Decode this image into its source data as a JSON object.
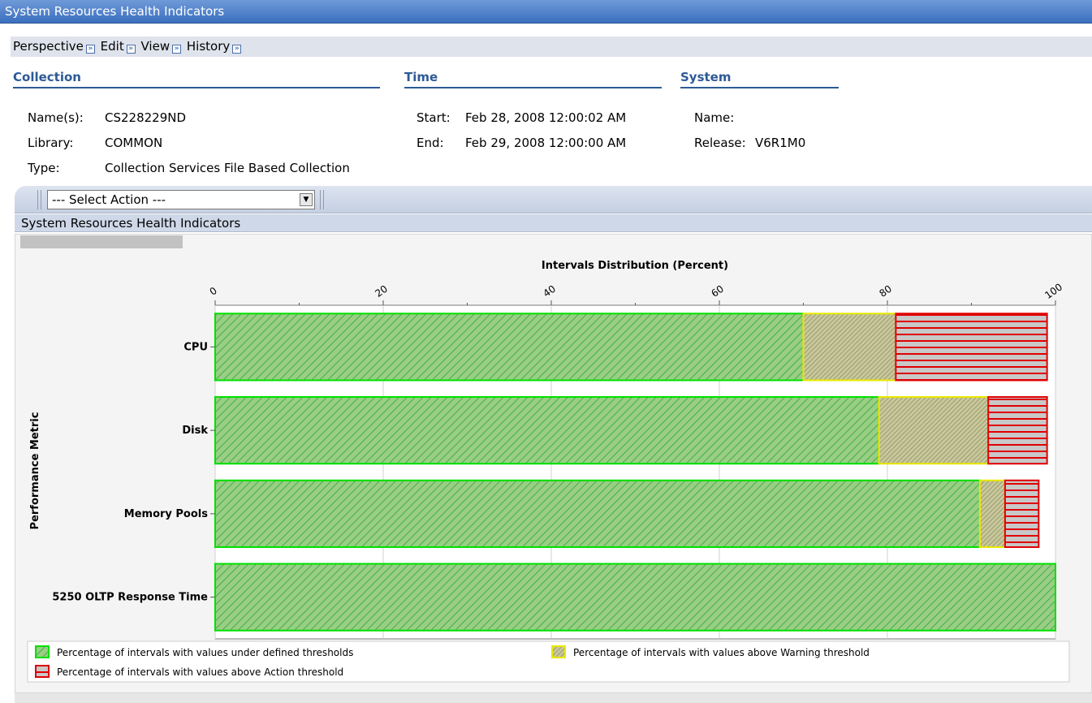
{
  "window": {
    "title": "System Resources Health Indicators"
  },
  "menu": {
    "items": [
      "Perspective",
      "Edit",
      "View",
      "History"
    ],
    "arrow_glyph": "»"
  },
  "collection": {
    "heading": "Collection",
    "names_label": "Name(s):",
    "names_value": "CS228229ND",
    "library_label": "Library:",
    "library_value": "COMMON",
    "type_label": "Type:",
    "type_value": "Collection Services File Based Collection"
  },
  "time": {
    "heading": "Time",
    "start_label": "Start:",
    "start_value": "Feb 28, 2008 12:00:02 AM",
    "end_label": "End:",
    "end_value": "Feb 29, 2008 12:00:00 AM"
  },
  "system": {
    "heading": "System",
    "name_label": "Name:",
    "name_value": "",
    "release_label": "Release:",
    "release_value": "V6R1M0"
  },
  "action_select": {
    "value": "--- Select Action ---"
  },
  "panel": {
    "title": "System Resources Health Indicators"
  },
  "colors": {
    "green_fill": "#9acd86",
    "green_stroke": "#00e000",
    "green_hatch": "#3fb23f",
    "yellow_fill": "#c8c89a",
    "yellow_stroke": "#e8e800",
    "yellow_hatch": "#8c8c6a",
    "red_fill": "#c8c8c8",
    "red_stroke": "#e00000"
  },
  "chart_data": {
    "type": "bar",
    "orientation": "horizontal",
    "stacked": true,
    "title": "Intervals Distribution (Percent)",
    "ylabel": "Performance Metric",
    "categories": [
      "CPU",
      "Disk",
      "Memory Pools",
      "5250 OLTP Response Time"
    ],
    "xlim": [
      0,
      100
    ],
    "xticks": [
      0,
      20,
      40,
      60,
      80,
      100
    ],
    "grid": true,
    "legend_position": "bottom",
    "series": [
      {
        "name": "Percentage of intervals with values under defined thresholds",
        "values": [
          70,
          79,
          91,
          100
        ]
      },
      {
        "name": "Percentage of intervals with values above Warning threshold",
        "values": [
          11,
          13,
          3,
          0
        ]
      },
      {
        "name": "Percentage of intervals with values above Action threshold",
        "values": [
          18,
          7,
          4,
          0
        ]
      }
    ]
  }
}
